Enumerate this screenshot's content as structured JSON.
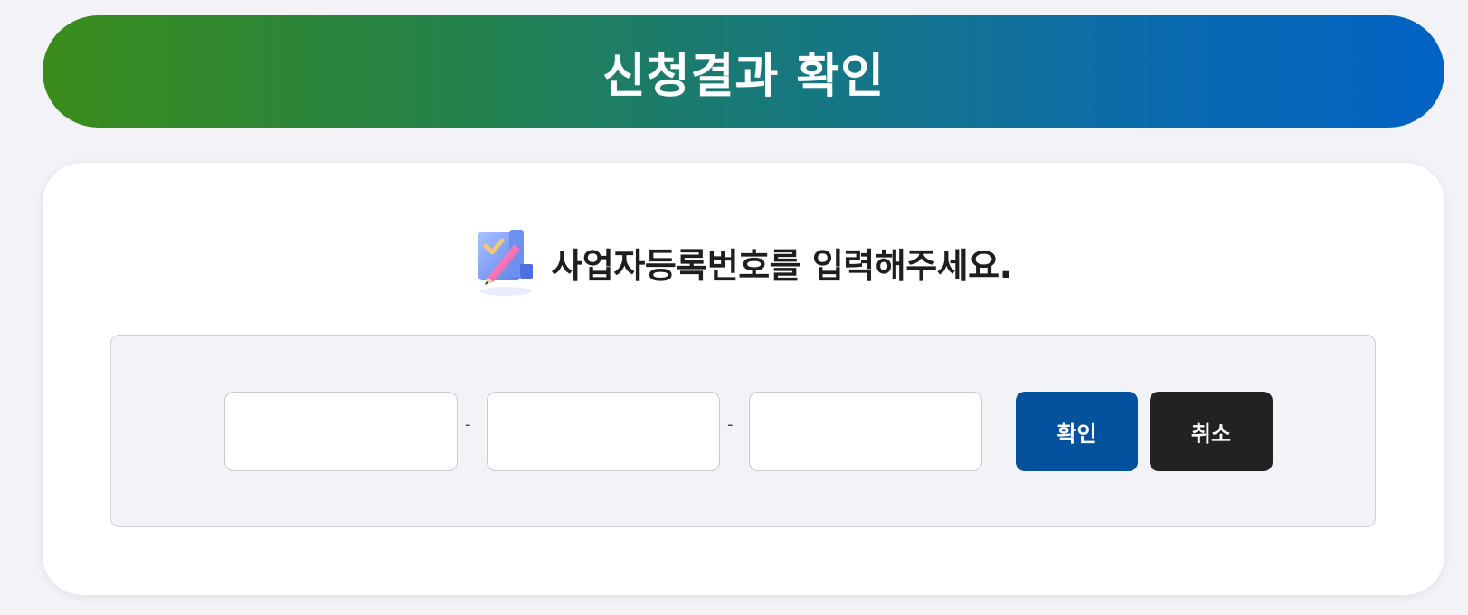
{
  "header": {
    "title": "신청결과 확인"
  },
  "card": {
    "prompt_icon": "pencil-checklist-icon",
    "prompt_text": "사업자등록번호를 입력해주세요."
  },
  "form": {
    "field1": {
      "value": "",
      "placeholder": ""
    },
    "separator1": "-",
    "field2": {
      "value": "",
      "placeholder": ""
    },
    "separator2": "-",
    "field3": {
      "value": "",
      "placeholder": ""
    },
    "confirm_label": "확인",
    "cancel_label": "취소"
  },
  "colors": {
    "banner_start": "#3a8c1a",
    "banner_end": "#0062c4",
    "confirm_button": "#04529e",
    "cancel_button": "#222222",
    "page_background": "#f3f3f7"
  }
}
